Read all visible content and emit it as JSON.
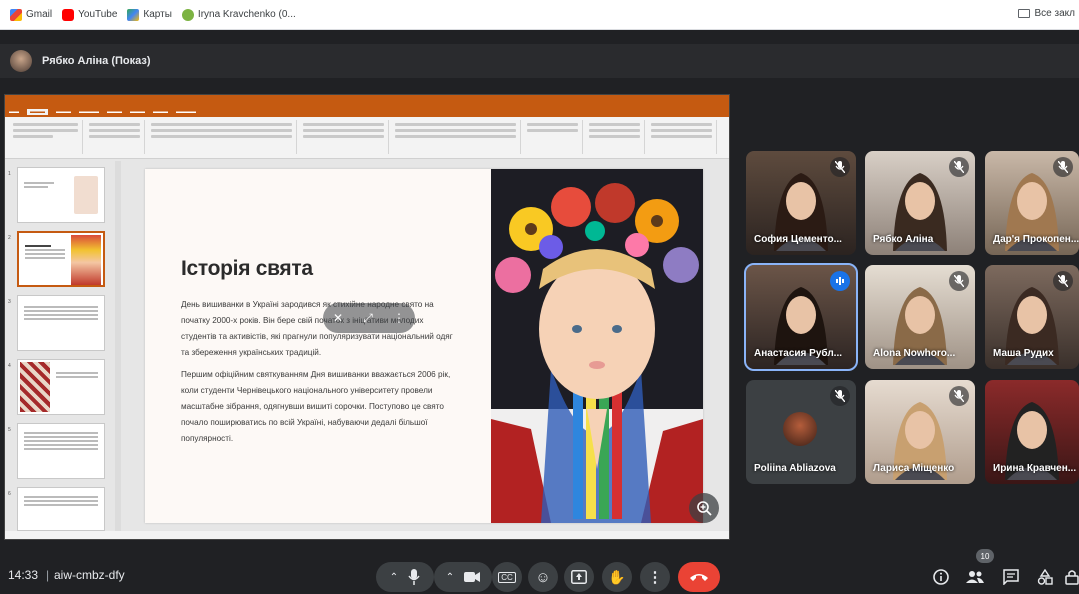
{
  "bookmarks": [
    {
      "label": "Gmail",
      "icon": "gmail-icon",
      "color": "#d93025"
    },
    {
      "label": "YouTube",
      "icon": "youtube-icon",
      "color": "#ff0000"
    },
    {
      "label": "Карты",
      "icon": "maps-icon",
      "color": "#34a853"
    },
    {
      "label": "Iryna Kravchenko (0...",
      "icon": "profile-icon",
      "color": "#7cb342"
    }
  ],
  "bookmarks_right": "Все закл",
  "presenter": {
    "title": "Рябко Аліна (Показ)"
  },
  "slide": {
    "title": "Історія свята",
    "paragraph1": "День вишиванки в Україні зародився як стихійне народне свято на початку 2000-х років. Він бере свій початок з ініціативи молодих студентів та активістів, які прагнули популяризувати національний одяг та збереження українських традицій.",
    "paragraph2": "Першим офіційним святкуванням Дня вишиванки вважається 2006 рік, коли студенти Чернівецького національного університету провели масштабне зібрання, одягнувши вишиті сорочки. Поступово це свято почало поширюватись по всій Україні, набуваючи дедалі більшої популярності."
  },
  "participants": [
    {
      "name": "София Цементо...",
      "muted": true,
      "speaking": false
    },
    {
      "name": "Рябко Аліна",
      "muted": true,
      "speaking": false
    },
    {
      "name": "Дар'я Прокопен...",
      "muted": true,
      "speaking": false
    },
    {
      "name": "Анастасия Рубл...",
      "muted": false,
      "speaking": true
    },
    {
      "name": "Alona Nowhoro...",
      "muted": true,
      "speaking": false
    },
    {
      "name": "Маша Рудих",
      "muted": true,
      "speaking": false
    },
    {
      "name": "Poliina Abliazova",
      "muted": true,
      "speaking": false
    },
    {
      "name": "Лариса Міщенко",
      "muted": true,
      "speaking": false
    },
    {
      "name": "Ирина Кравчен...",
      "muted": false,
      "speaking": false
    }
  ],
  "bottom": {
    "time": "14:33",
    "separator": "|",
    "meeting_code": "aiw-cmbz-dfy",
    "participants_count": "10"
  },
  "colors": {
    "accent": "#1a73e8",
    "end_call": "#ea4335",
    "ppt": "#c55a11"
  }
}
